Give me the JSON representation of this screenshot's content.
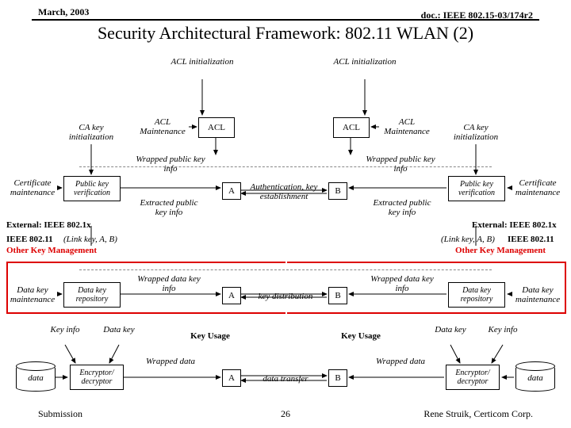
{
  "header": {
    "date": "March, 2003",
    "doc": "doc.: IEEE 802.15-03/174r2",
    "title": "Security Architectural Framework: 802.11 WLAN (2)"
  },
  "labels": {
    "acl_init": "ACL initialization",
    "acl_maint": "ACL Maintenance",
    "ca_key_init": "CA key initialization",
    "acl": "ACL",
    "wrapped_pub": "Wrapped public key info",
    "cert_maint": "Certificate maintenance",
    "pub_ver": "Public key verification",
    "extracted_pub": "Extracted public key info",
    "auth_est": "Authentication, key establishment",
    "external": "External: IEEE 802.1x",
    "ieee80211": "IEEE 802.11",
    "link_tuple": "(Link key, A, B)",
    "okm": "Other Key Management",
    "wrapped_data_key": "Wrapped data key info",
    "data_key_maint": "Data key maintenance",
    "data_key_repo": "Data key repository",
    "key_dist": "key distribution",
    "key_info": "Key info",
    "data_key": "Data key",
    "key_usage": "Key Usage",
    "wrapped_data": "Wrapped data",
    "data": "data",
    "enc_dec": "Encryptor/ decryptor",
    "data_transfer": "data transfer",
    "A": "A",
    "B": "B"
  },
  "footer": {
    "left": "Submission",
    "page": "26",
    "right": "Rene Struik, Certicom Corp."
  }
}
